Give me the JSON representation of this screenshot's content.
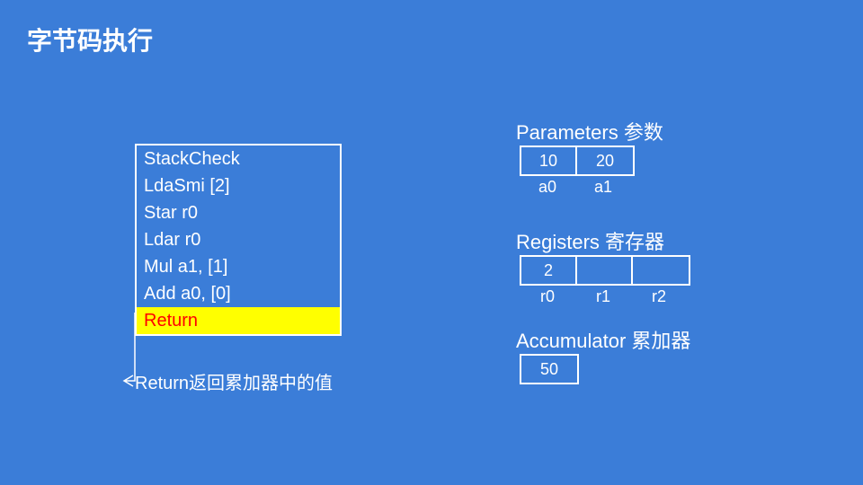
{
  "title": "字节码执行",
  "bytecode": {
    "lines": [
      "StackCheck",
      "LdaSmi [2]",
      "Star r0",
      "Ldar r0",
      "Mul a1, [1]",
      "Add a0, [0]",
      "Return"
    ],
    "highlight_index": 6
  },
  "explanation": "Return返回累加器中的值",
  "parameters": {
    "label": "Parameters 参数",
    "cells": [
      "10",
      "20"
    ],
    "names": [
      "a0",
      "a1"
    ]
  },
  "registers": {
    "label": "Registers 寄存器",
    "cells": [
      "2",
      "",
      ""
    ],
    "names": [
      "r0",
      "r1",
      "r2"
    ]
  },
  "accumulator": {
    "label": "Accumulator 累加器",
    "cells": [
      "50"
    ]
  }
}
